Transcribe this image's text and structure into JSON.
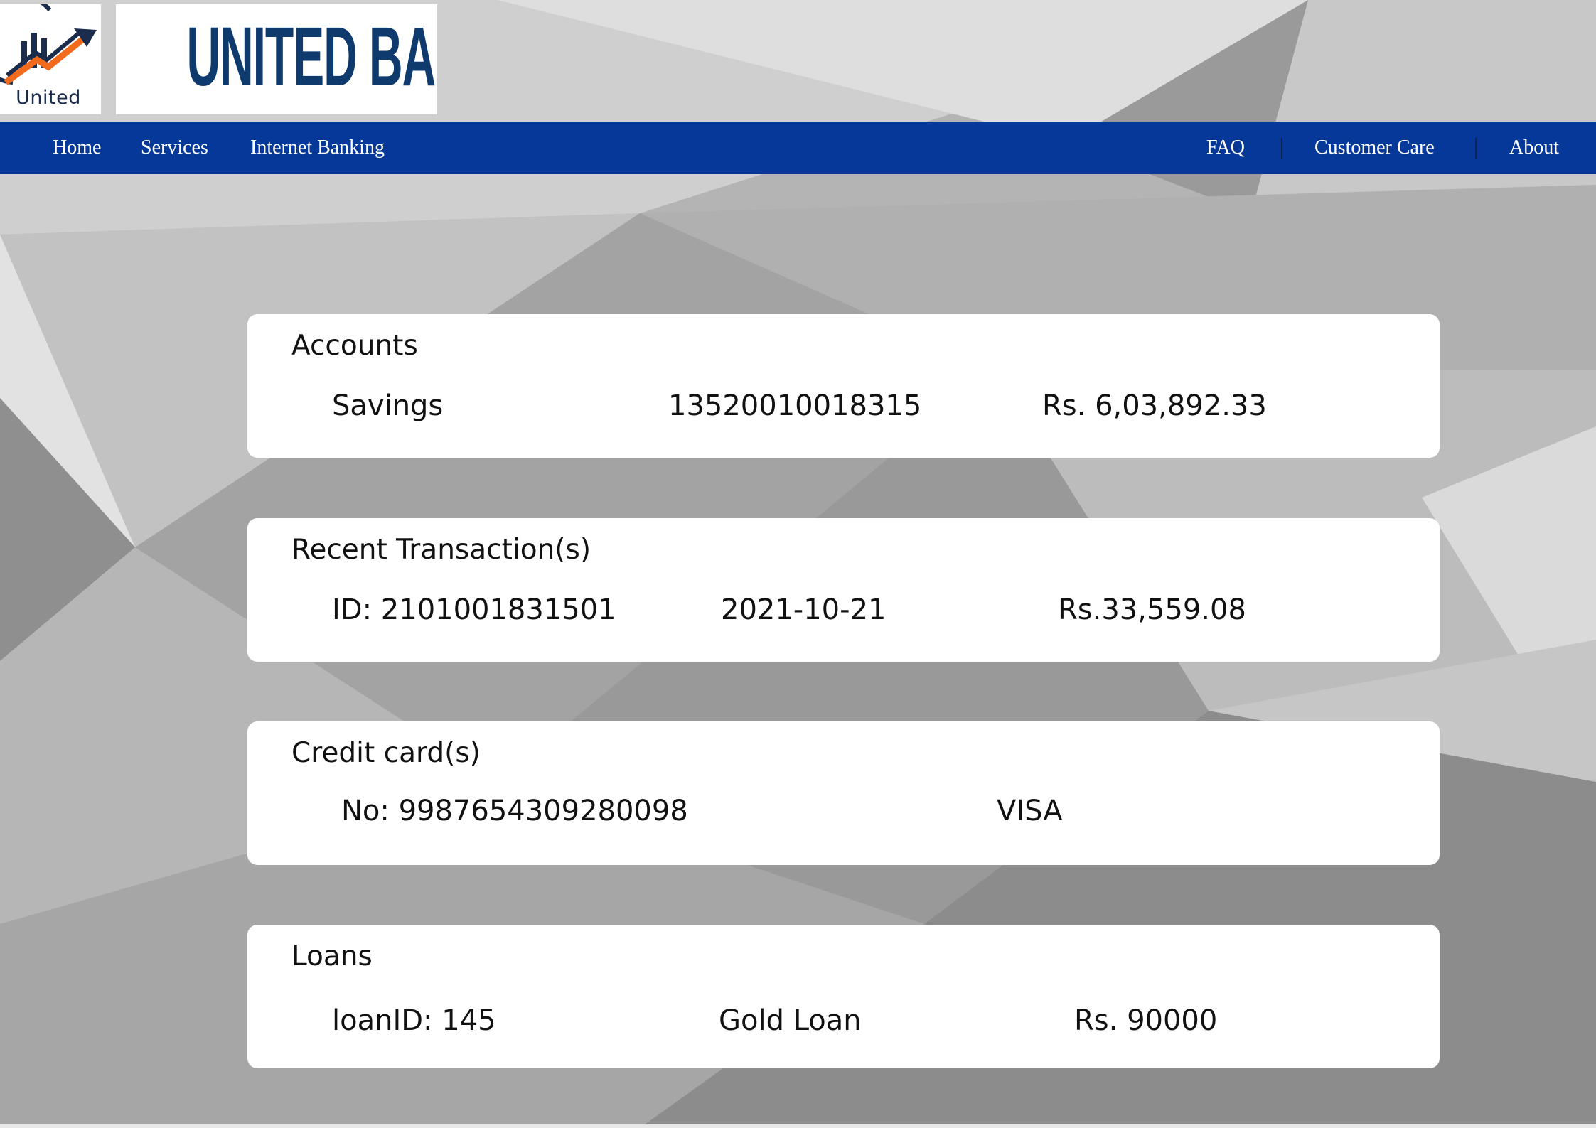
{
  "brand": {
    "logo_caption": "United",
    "wordmark": "UNITED BANK"
  },
  "nav": {
    "left": [
      "Home",
      "Services",
      "Internet Banking"
    ],
    "right": [
      "FAQ",
      "Customer Care",
      "About"
    ]
  },
  "accounts": {
    "title": "Accounts",
    "type": "Savings",
    "number": "13520010018315",
    "balance": "Rs. 6,03,892.33"
  },
  "transactions": {
    "title": "Recent Transaction(s)",
    "id": "ID: 2101001831501",
    "date": "2021-10-21",
    "amount": "Rs.33,559.08"
  },
  "credit_cards": {
    "title": "Credit card(s)",
    "number": "No: 9987654309280098",
    "network": "VISA"
  },
  "loans": {
    "title": "Loans",
    "id": "loanID: 145",
    "type": "Gold Loan",
    "amount": "Rs. 90000"
  },
  "colors": {
    "navbar": "#063899",
    "wordmark": "#0f3a6e",
    "logo_arrow": "#f26a1b"
  }
}
